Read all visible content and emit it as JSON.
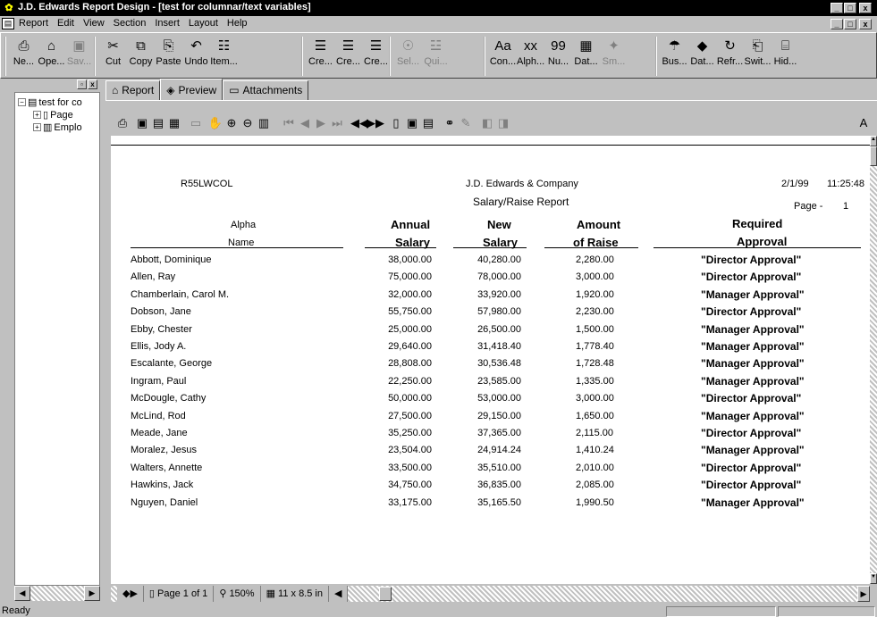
{
  "window": {
    "title": "J.D. Edwards Report Design - [test for columnar/text variables]",
    "min_label": "_",
    "max_label": "□",
    "close_label": "x"
  },
  "menu": [
    "Report",
    "Edit",
    "View",
    "Section",
    "Insert",
    "Layout",
    "Help"
  ],
  "toolbar": {
    "groups": [
      [
        {
          "label": "Ne...",
          "icon": "⎙"
        },
        {
          "label": "Ope...",
          "icon": "⌂"
        },
        {
          "label": "Sav...",
          "icon": "▣",
          "disabled": true
        }
      ],
      [
        {
          "label": "Cut",
          "icon": "✂"
        },
        {
          "label": "Copy",
          "icon": "⧉"
        },
        {
          "label": "Paste",
          "icon": "⎘"
        },
        {
          "label": "Undo",
          "icon": "↶"
        },
        {
          "label": "Item...",
          "icon": "☷"
        }
      ],
      [
        {
          "label": "Cre...",
          "icon": "☰"
        },
        {
          "label": "Cre...",
          "icon": "☰"
        },
        {
          "label": "Cre...",
          "icon": "☰"
        }
      ],
      [
        {
          "label": "Sel...",
          "icon": "☉",
          "disabled": true
        },
        {
          "label": "Qui...",
          "icon": "☳",
          "disabled": true
        }
      ],
      [
        {
          "label": "Con...",
          "icon": "Aa"
        },
        {
          "label": "Alph...",
          "icon": "xx"
        },
        {
          "label": "Nu...",
          "icon": "99"
        },
        {
          "label": "Dat...",
          "icon": "▦"
        },
        {
          "label": "Sm...",
          "icon": "✦",
          "disabled": true
        }
      ],
      [
        {
          "label": "Bus...",
          "icon": "☂"
        },
        {
          "label": "Dat...",
          "icon": "◆"
        },
        {
          "label": "Refr...",
          "icon": "↻"
        },
        {
          "label": "Swit...",
          "icon": "⎗"
        },
        {
          "label": "Hid...",
          "icon": "⌸"
        }
      ]
    ]
  },
  "tree": {
    "root": "test for co",
    "children": [
      "Page",
      "Emplo"
    ]
  },
  "tabs": [
    "Report",
    "Preview",
    "Attachments"
  ],
  "report": {
    "program_id": "R55LWCOL",
    "company": "J.D. Edwards & Company",
    "title": "Salary/Raise Report",
    "date": "2/1/99",
    "time": "11:25:48",
    "page_label": "Page -",
    "page_num": "1",
    "headers": {
      "name_top": "Alpha",
      "name_bottom": "Name",
      "annual_top": "Annual",
      "annual_bottom": "Salary",
      "new_top": "New",
      "new_bottom": "Salary",
      "amount_top": "Amount",
      "amount_bottom": "of Raise",
      "approval_top": "Required",
      "approval_bottom": "Approval"
    },
    "rows": [
      {
        "name": "Abbott, Dominique",
        "annual": "38,000.00",
        "new": "40,280.00",
        "raise": "2,280.00",
        "approval": "\"Director Approval\""
      },
      {
        "name": "Allen, Ray",
        "annual": "75,000.00",
        "new": "78,000.00",
        "raise": "3,000.00",
        "approval": "\"Director Approval\""
      },
      {
        "name": "Chamberlain, Carol M.",
        "annual": "32,000.00",
        "new": "33,920.00",
        "raise": "1,920.00",
        "approval": "\"Manager Approval\""
      },
      {
        "name": "Dobson, Jane",
        "annual": "55,750.00",
        "new": "57,980.00",
        "raise": "2,230.00",
        "approval": "\"Director Approval\""
      },
      {
        "name": "Ebby, Chester",
        "annual": "25,000.00",
        "new": "26,500.00",
        "raise": "1,500.00",
        "approval": "\"Manager Approval\""
      },
      {
        "name": "Ellis, Jody A.",
        "annual": "29,640.00",
        "new": "31,418.40",
        "raise": "1,778.40",
        "approval": "\"Manager Approval\""
      },
      {
        "name": "Escalante, George",
        "annual": "28,808.00",
        "new": "30,536.48",
        "raise": "1,728.48",
        "approval": "\"Manager Approval\""
      },
      {
        "name": "Ingram, Paul",
        "annual": "22,250.00",
        "new": "23,585.00",
        "raise": "1,335.00",
        "approval": "\"Manager Approval\""
      },
      {
        "name": "McDougle, Cathy",
        "annual": "50,000.00",
        "new": "53,000.00",
        "raise": "3,000.00",
        "approval": "\"Director Approval\""
      },
      {
        "name": "McLind, Rod",
        "annual": "27,500.00",
        "new": "29,150.00",
        "raise": "1,650.00",
        "approval": "\"Manager Approval\""
      },
      {
        "name": "Meade, Jane",
        "annual": "35,250.00",
        "new": "37,365.00",
        "raise": "2,115.00",
        "approval": "\"Director Approval\""
      },
      {
        "name": "Moralez, Jesus",
        "annual": "23,504.00",
        "new": "24,914.24",
        "raise": "1,410.24",
        "approval": "\"Manager Approval\""
      },
      {
        "name": "Walters, Annette",
        "annual": "33,500.00",
        "new": "35,510.00",
        "raise": "2,010.00",
        "approval": "\"Director Approval\""
      },
      {
        "name": "Hawkins, Jack",
        "annual": "34,750.00",
        "new": "36,835.00",
        "raise": "2,085.00",
        "approval": "\"Director Approval\""
      },
      {
        "name": "Nguyen, Daniel",
        "annual": "33,175.00",
        "new": "35,165.50",
        "raise": "1,990.50",
        "approval": "\"Manager Approval\""
      }
    ]
  },
  "bottom": {
    "page_info": "Page 1 of 1",
    "zoom": "150%",
    "paper": "11 x 8.5 in"
  },
  "status": "Ready"
}
